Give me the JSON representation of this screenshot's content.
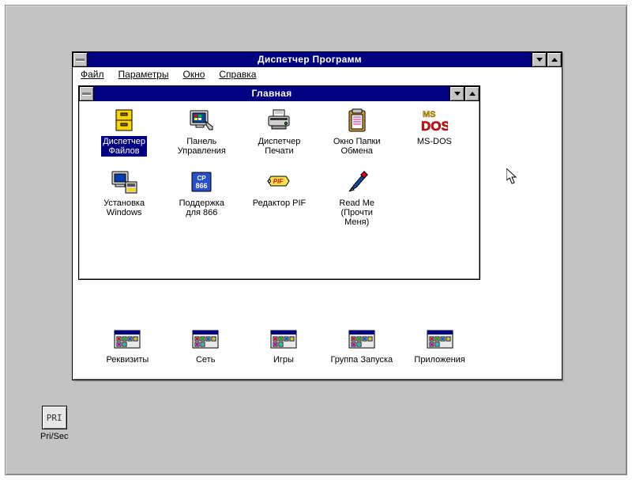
{
  "outerWindow": {
    "title": "Диспетчер Программ",
    "menu": {
      "file": "Файл",
      "options": "Параметры",
      "window": "Окно",
      "help": "Справка"
    }
  },
  "innerWindow": {
    "title": "Главная",
    "icons": {
      "fileManager": "Диспетчер\nФайлов",
      "controlPanel": "Панель\nУправления",
      "printManager": "Диспетчер\nПечати",
      "clipboard": "Окно Папки\nОбмена",
      "msdos": "MS-DOS",
      "setup": "Установка\nWindows",
      "cp866": "Поддержка\nдля 866",
      "pifEditor": "Редактор PIF",
      "readme": "Read Me\n(Прочти\nМеня)"
    }
  },
  "groups": {
    "requisites": "Реквизиты",
    "network": "Сеть",
    "games": "Игры",
    "startup": "Группа Запуска",
    "applications": "Приложения"
  },
  "desktopIcon": {
    "badge": "PRI",
    "label": "Pri/Sec"
  }
}
